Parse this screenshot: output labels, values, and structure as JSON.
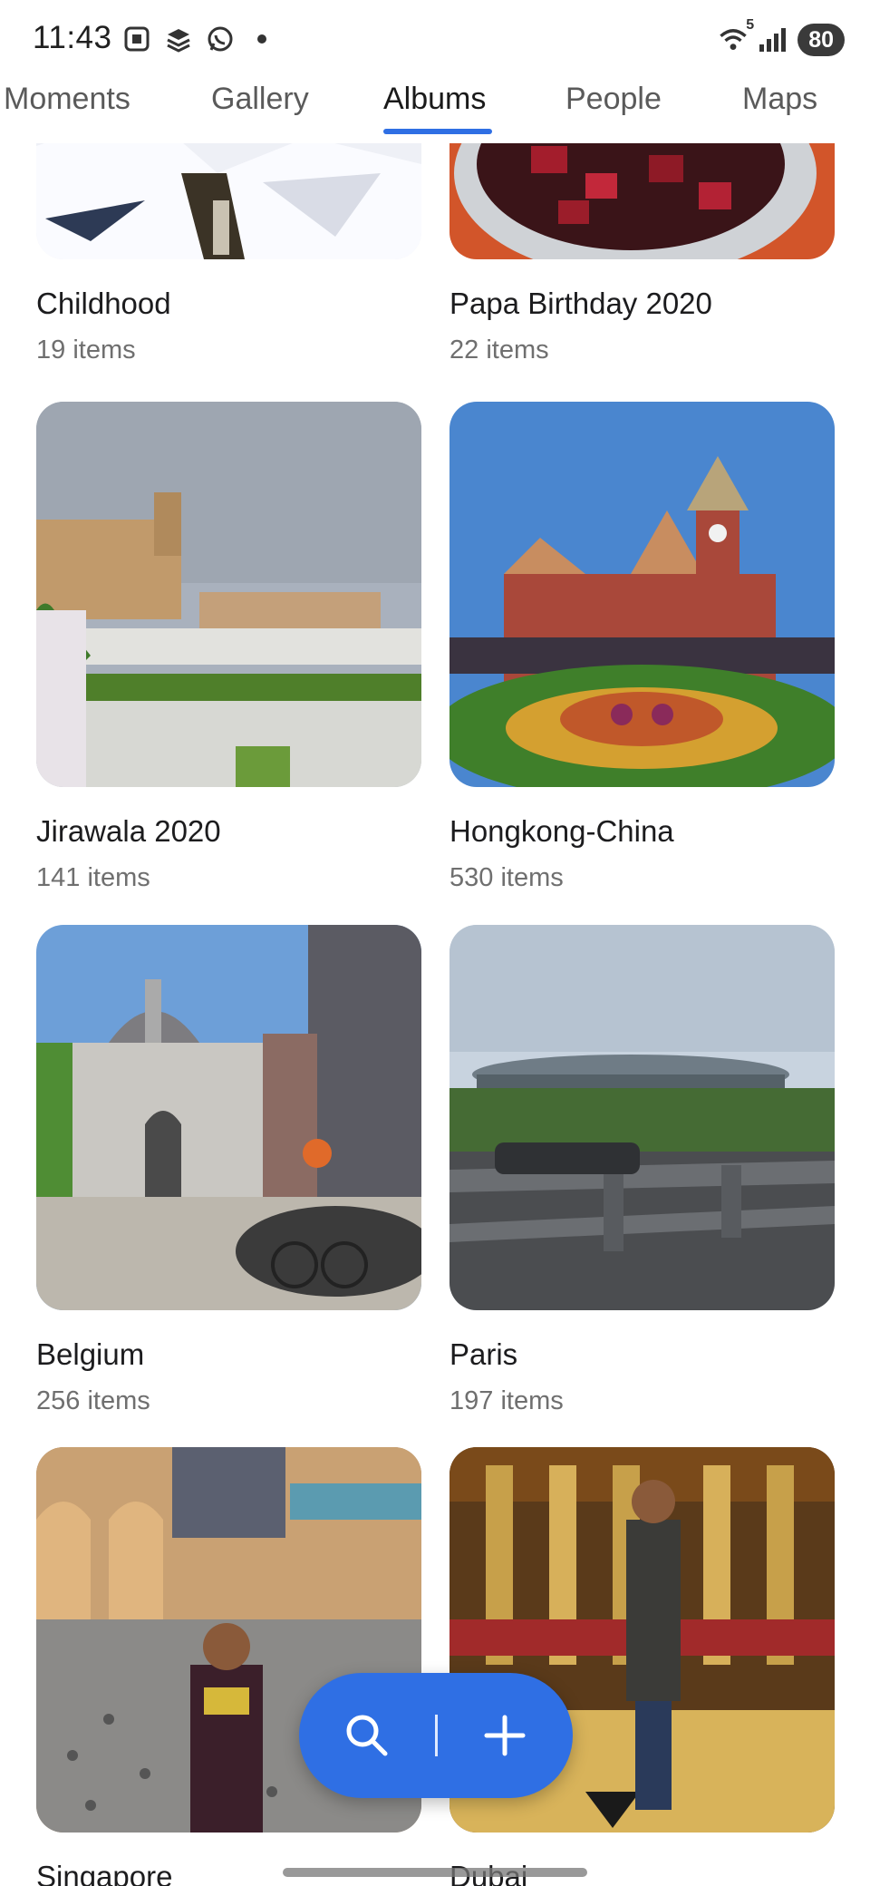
{
  "status_bar": {
    "time": "11:43",
    "battery": "80",
    "network": "5"
  },
  "tabs": [
    {
      "label": "Moments",
      "active": false
    },
    {
      "label": "Gallery",
      "active": false
    },
    {
      "label": "Albums",
      "active": true
    },
    {
      "label": "People",
      "active": false
    },
    {
      "label": "Maps",
      "active": false
    }
  ],
  "albums": [
    {
      "title": "Childhood",
      "count": "19 items"
    },
    {
      "title": "Papa Birthday 2020",
      "count": "22 items"
    },
    {
      "title": "Jirawala 2020",
      "count": "141 items"
    },
    {
      "title": "Hongkong-China",
      "count": "530 items"
    },
    {
      "title": "Belgium",
      "count": "256 items"
    },
    {
      "title": "Paris",
      "count": "197 items"
    },
    {
      "title": "Singapore",
      "count": ""
    },
    {
      "title": "Dubai",
      "count": ""
    }
  ],
  "fab": {
    "search_icon": "search-icon",
    "add_icon": "plus-icon"
  },
  "colors": {
    "accent": "#2f6fe4",
    "text_primary": "#1c1c1e",
    "text_secondary": "#6f6f6f"
  }
}
